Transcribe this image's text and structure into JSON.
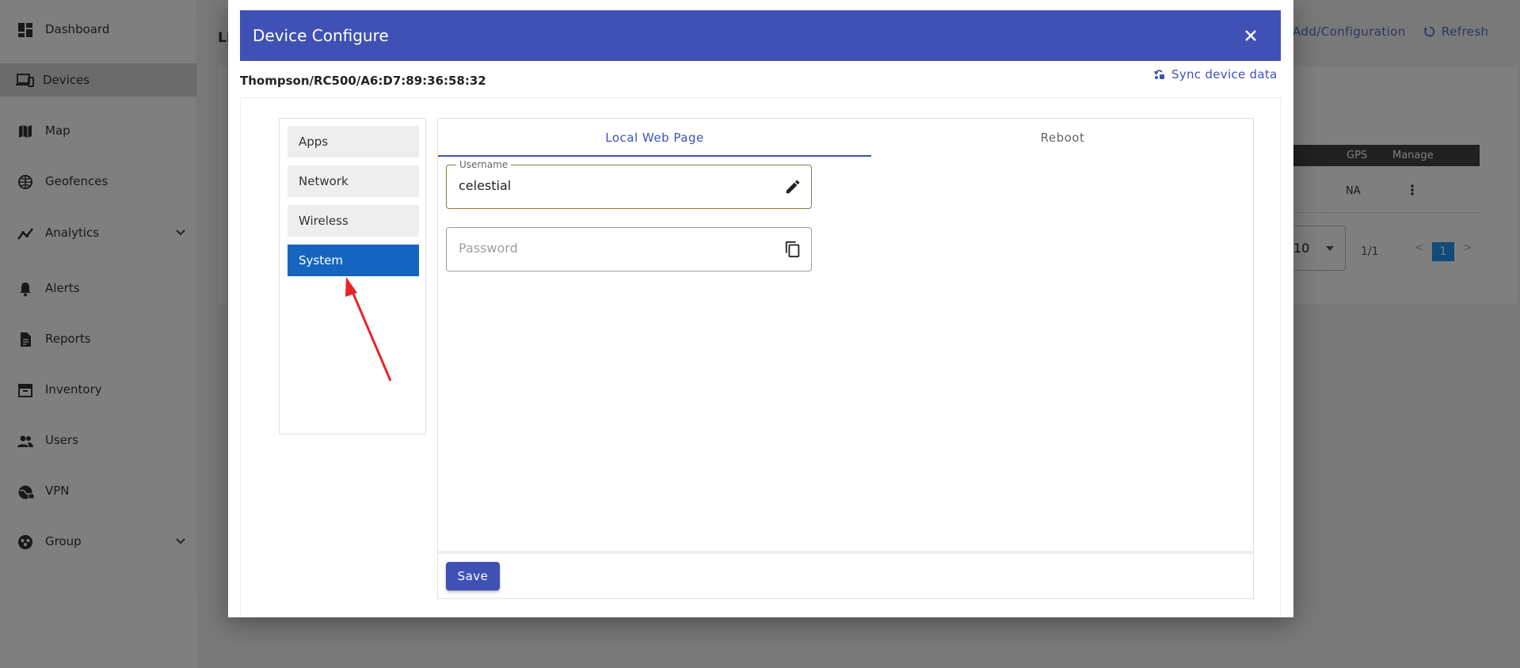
{
  "sidebar": {
    "items": [
      {
        "label": "Dashboard",
        "icon": "dashboard-icon"
      },
      {
        "label": "Devices",
        "icon": "devices-icon",
        "active": true
      },
      {
        "label": "Map",
        "icon": "map-icon"
      },
      {
        "label": "Geofences",
        "icon": "geofence-icon"
      },
      {
        "label": "Analytics",
        "icon": "analytics-icon",
        "expandable": true
      },
      {
        "label": "Alerts",
        "icon": "bell-icon"
      },
      {
        "label": "Reports",
        "icon": "report-icon"
      },
      {
        "label": "Inventory",
        "icon": "inventory-icon"
      },
      {
        "label": "Users",
        "icon": "users-icon"
      },
      {
        "label": "VPN",
        "icon": "vpn-icon"
      },
      {
        "label": "Group",
        "icon": "group-icon",
        "expandable": true
      }
    ]
  },
  "background": {
    "list_title": "Li",
    "add_config_label": "Add/Configuration",
    "refresh_label": "Refresh",
    "table": {
      "headers": [
        "GPS",
        "Manage"
      ],
      "row": {
        "gps": "NA"
      }
    },
    "pagination": {
      "page_size": "10",
      "page_count": "1/1",
      "prev": "<",
      "current": "1",
      "next": ">"
    }
  },
  "dialog": {
    "title": "Device Configure",
    "device_path": "Thompson/RC500/A6:D7:89:36:58:32",
    "sync_label": "Sync device data",
    "menu": [
      {
        "label": "Apps"
      },
      {
        "label": "Network"
      },
      {
        "label": "Wireless"
      },
      {
        "label": "System",
        "active": true
      }
    ],
    "tabs": [
      {
        "label": "Local Web Page",
        "active": true
      },
      {
        "label": "Reboot"
      }
    ],
    "username": {
      "legend": "Username",
      "value": "celestial",
      "icon": "pencil-icon"
    },
    "password": {
      "placeholder": "Password",
      "value": "",
      "icon": "copy-icon"
    },
    "save_label": "Save"
  },
  "colors": {
    "primary": "#3f51b5",
    "active_menu": "#1565c0",
    "annotation_arrow": "#e8242a",
    "pager_active": "#2196f3"
  }
}
